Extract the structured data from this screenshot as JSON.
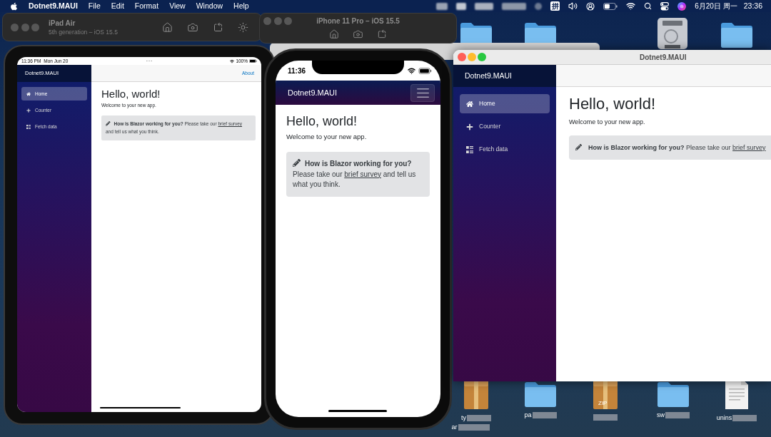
{
  "menu_bar": {
    "app_name": "Dotnet9.MAUI",
    "menus": [
      "File",
      "Edit",
      "Format",
      "View",
      "Window",
      "Help"
    ],
    "input_method": "拼",
    "date": "6月20日 周一",
    "time": "23:36"
  },
  "ipad_simulator": {
    "title": "iPad Air",
    "subtitle": "5th generation – iOS 15.5",
    "status_time": "11:36 PM",
    "status_date": "Mon Jun 20",
    "battery": "100%",
    "app": {
      "brand": "Dotnet9.MAUI",
      "nav": [
        {
          "label": "Home",
          "selected": true
        },
        {
          "label": "Counter",
          "selected": false
        },
        {
          "label": "Fetch data",
          "selected": false
        }
      ],
      "top_link": "About",
      "heading": "Hello, world!",
      "intro": "Welcome to your new app.",
      "survey": {
        "question": "How is Blazor working for you?",
        "text_before_link": "Please take our",
        "link": "brief survey",
        "text_after_link": "and tell us what you think."
      }
    }
  },
  "iphone_simulator": {
    "title": "iPhone 11 Pro – iOS 15.5",
    "status_time": "11:36",
    "app": {
      "brand": "Dotnet9.MAUI",
      "heading": "Hello, world!",
      "intro": "Welcome to your new app.",
      "survey": {
        "question": "How is Blazor working for you?",
        "text_before_link": "Please take our",
        "link": "brief survey",
        "text_after_link": "and tell us what you think."
      }
    }
  },
  "mac_window": {
    "title": "Dotnet9.MAUI",
    "app": {
      "brand": "Dotnet9.MAUI",
      "nav": [
        {
          "label": "Home",
          "selected": true
        },
        {
          "label": "Counter",
          "selected": false
        },
        {
          "label": "Fetch data",
          "selected": false
        }
      ],
      "heading": "Hello, world!",
      "intro": "Welcome to your new app.",
      "survey": {
        "question": "How is Blazor working for you?",
        "text_before_link": "Please take our",
        "link": "brief survey"
      }
    }
  },
  "desktop_icons": [
    {
      "kind": "folder"
    },
    {
      "kind": "folder"
    },
    {
      "kind": "drive"
    },
    {
      "kind": "folder"
    },
    {
      "kind": "package",
      "label": "ty",
      "label_line_2": "ar"
    },
    {
      "kind": "folder",
      "label": "pa"
    },
    {
      "kind": "zip",
      "badge": "ZIP"
    },
    {
      "kind": "folder",
      "label": "sw"
    },
    {
      "kind": "document",
      "label": "unins"
    }
  ]
}
